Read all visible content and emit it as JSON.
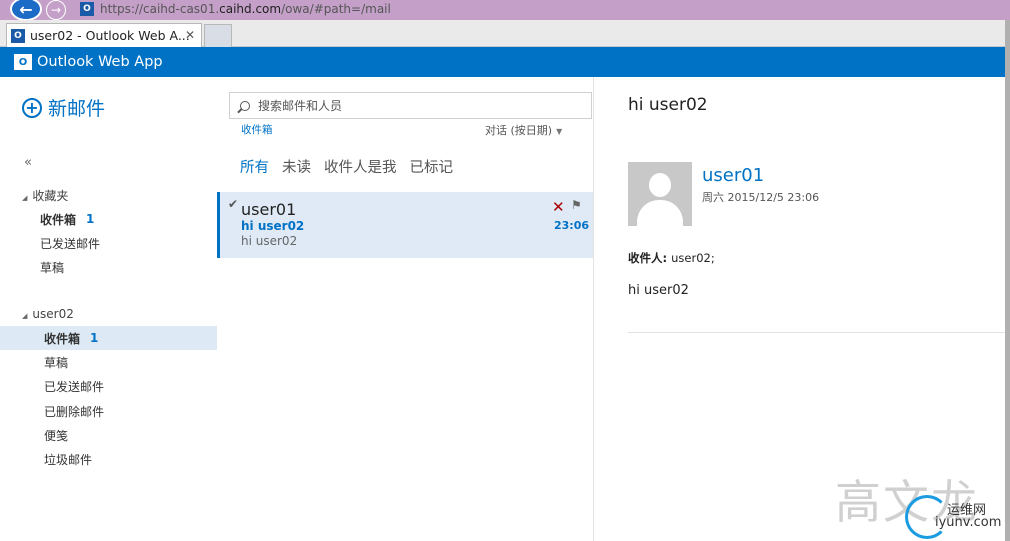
{
  "browser": {
    "url_prefix": "https://caihd-cas01.",
    "url_domain": "caihd.com",
    "url_suffix": "/owa/#path=/mail",
    "tab_title": "user02 - Outlook Web A...",
    "tab_close": "✕",
    "favicon_letter": "O"
  },
  "app": {
    "title": "Outlook Web App",
    "logo_letter": "O"
  },
  "nav": {
    "new_mail": "新邮件",
    "collapse": "«",
    "favorites": {
      "header": "收藏夹",
      "items": [
        {
          "label": "收件箱",
          "count": "1"
        },
        {
          "label": "已发送邮件"
        },
        {
          "label": "草稿"
        }
      ]
    },
    "mailbox": {
      "header": "user02",
      "items": [
        {
          "label": "收件箱",
          "count": "1"
        },
        {
          "label": "草稿"
        },
        {
          "label": "已发送邮件"
        },
        {
          "label": "已删除邮件"
        },
        {
          "label": "便笺"
        },
        {
          "label": "垃圾邮件"
        }
      ]
    }
  },
  "list": {
    "search_placeholder": "搜索邮件和人员",
    "folder": "收件箱",
    "sort": "对话 (按日期)",
    "filters": [
      "所有",
      "未读",
      "收件人是我",
      "已标记"
    ],
    "message": {
      "sender": "user01",
      "subject": "hi user02",
      "preview": "hi user02",
      "time": "23:06",
      "delete": "✕",
      "flag": "⚑"
    }
  },
  "reading": {
    "subject": "hi user02",
    "sender": "user01",
    "date": "周六 2015/12/5 23:06",
    "to_label": "收件人:",
    "to_value": "user02;",
    "body": "hi user02"
  },
  "watermark": {
    "chars": "高文龙",
    "site1": "运维网",
    "site2": "iyunv.com"
  },
  "colors": {
    "accent": "#0072c6",
    "selected_bg": "#dfeaf6",
    "delete": "#a00000"
  }
}
